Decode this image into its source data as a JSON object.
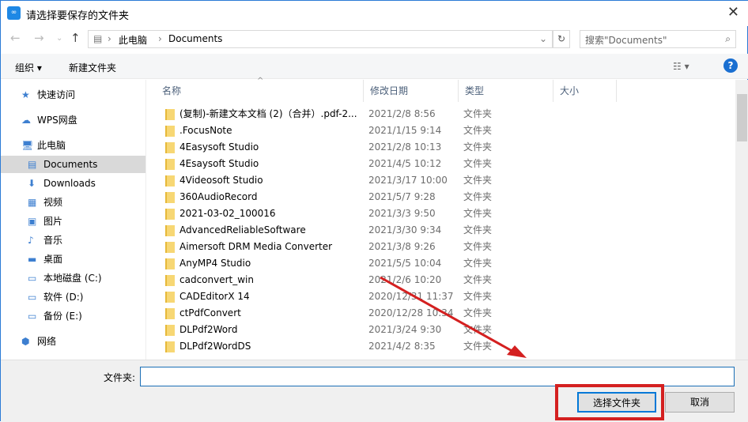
{
  "window": {
    "title": "请选择要保存的文件夹",
    "app_icon": "folder-app-icon"
  },
  "nav": {
    "breadcrumb": [
      "此电脑",
      "Documents"
    ],
    "search_placeholder": "搜索\"Documents\""
  },
  "toolbar": {
    "organize": "组织 ▾",
    "new_folder": "新建文件夹",
    "help": "?"
  },
  "sidebar": [
    {
      "label": "快速访问",
      "icon": "★"
    },
    {
      "label": "WPS网盘",
      "icon": "☁"
    },
    {
      "label": "此电脑",
      "icon": "🖥"
    },
    {
      "label": "Documents",
      "icon": "▤"
    },
    {
      "label": "Downloads",
      "icon": "⬇"
    },
    {
      "label": "视频",
      "icon": "▦"
    },
    {
      "label": "图片",
      "icon": "▣"
    },
    {
      "label": "音乐",
      "icon": "♪"
    },
    {
      "label": "桌面",
      "icon": "▬"
    },
    {
      "label": "本地磁盘 (C:)",
      "icon": "▭"
    },
    {
      "label": "软件 (D:)",
      "icon": "▭"
    },
    {
      "label": "备份 (E:)",
      "icon": "▭"
    },
    {
      "label": "网络",
      "icon": "⬢"
    }
  ],
  "columns": [
    "名称",
    "修改日期",
    "类型",
    "大小"
  ],
  "files": [
    {
      "name": "(复制)-新建文本文档 (2)（合并）.pdf-2...",
      "date": "2021/2/8 8:56",
      "type": "文件夹"
    },
    {
      "name": ".FocusNote",
      "date": "2021/1/15 9:14",
      "type": "文件夹"
    },
    {
      "name": "4Easysoft Studio",
      "date": "2021/2/8 10:13",
      "type": "文件夹"
    },
    {
      "name": "4Esaysoft Studio",
      "date": "2021/4/5 10:12",
      "type": "文件夹"
    },
    {
      "name": "4Videosoft Studio",
      "date": "2021/3/17 10:00",
      "type": "文件夹"
    },
    {
      "name": "360AudioRecord",
      "date": "2021/5/7 9:28",
      "type": "文件夹"
    },
    {
      "name": "2021-03-02_100016",
      "date": "2021/3/3 9:50",
      "type": "文件夹"
    },
    {
      "name": "AdvancedReliableSoftware",
      "date": "2021/3/30 9:34",
      "type": "文件夹"
    },
    {
      "name": "Aimersoft DRM Media Converter",
      "date": "2021/3/8 9:26",
      "type": "文件夹"
    },
    {
      "name": "AnyMP4 Studio",
      "date": "2021/5/5 10:04",
      "type": "文件夹"
    },
    {
      "name": "cadconvert_win",
      "date": "2021/2/6 10:20",
      "type": "文件夹"
    },
    {
      "name": "CADEditorX 14",
      "date": "2020/12/31 11:37",
      "type": "文件夹"
    },
    {
      "name": "ctPdfConvert",
      "date": "2020/12/28 10:34",
      "type": "文件夹"
    },
    {
      "name": "DLPdf2Word",
      "date": "2021/3/24 9:30",
      "type": "文件夹"
    },
    {
      "name": "DLPdf2WordDS",
      "date": "2021/4/2 8:35",
      "type": "文件夹"
    }
  ],
  "footer": {
    "folder_label": "文件夹:",
    "folder_value": "",
    "ok": "选择文件夹",
    "cancel": "取消"
  },
  "colors": {
    "accent": "#0078d7",
    "annotation": "#d42020"
  }
}
